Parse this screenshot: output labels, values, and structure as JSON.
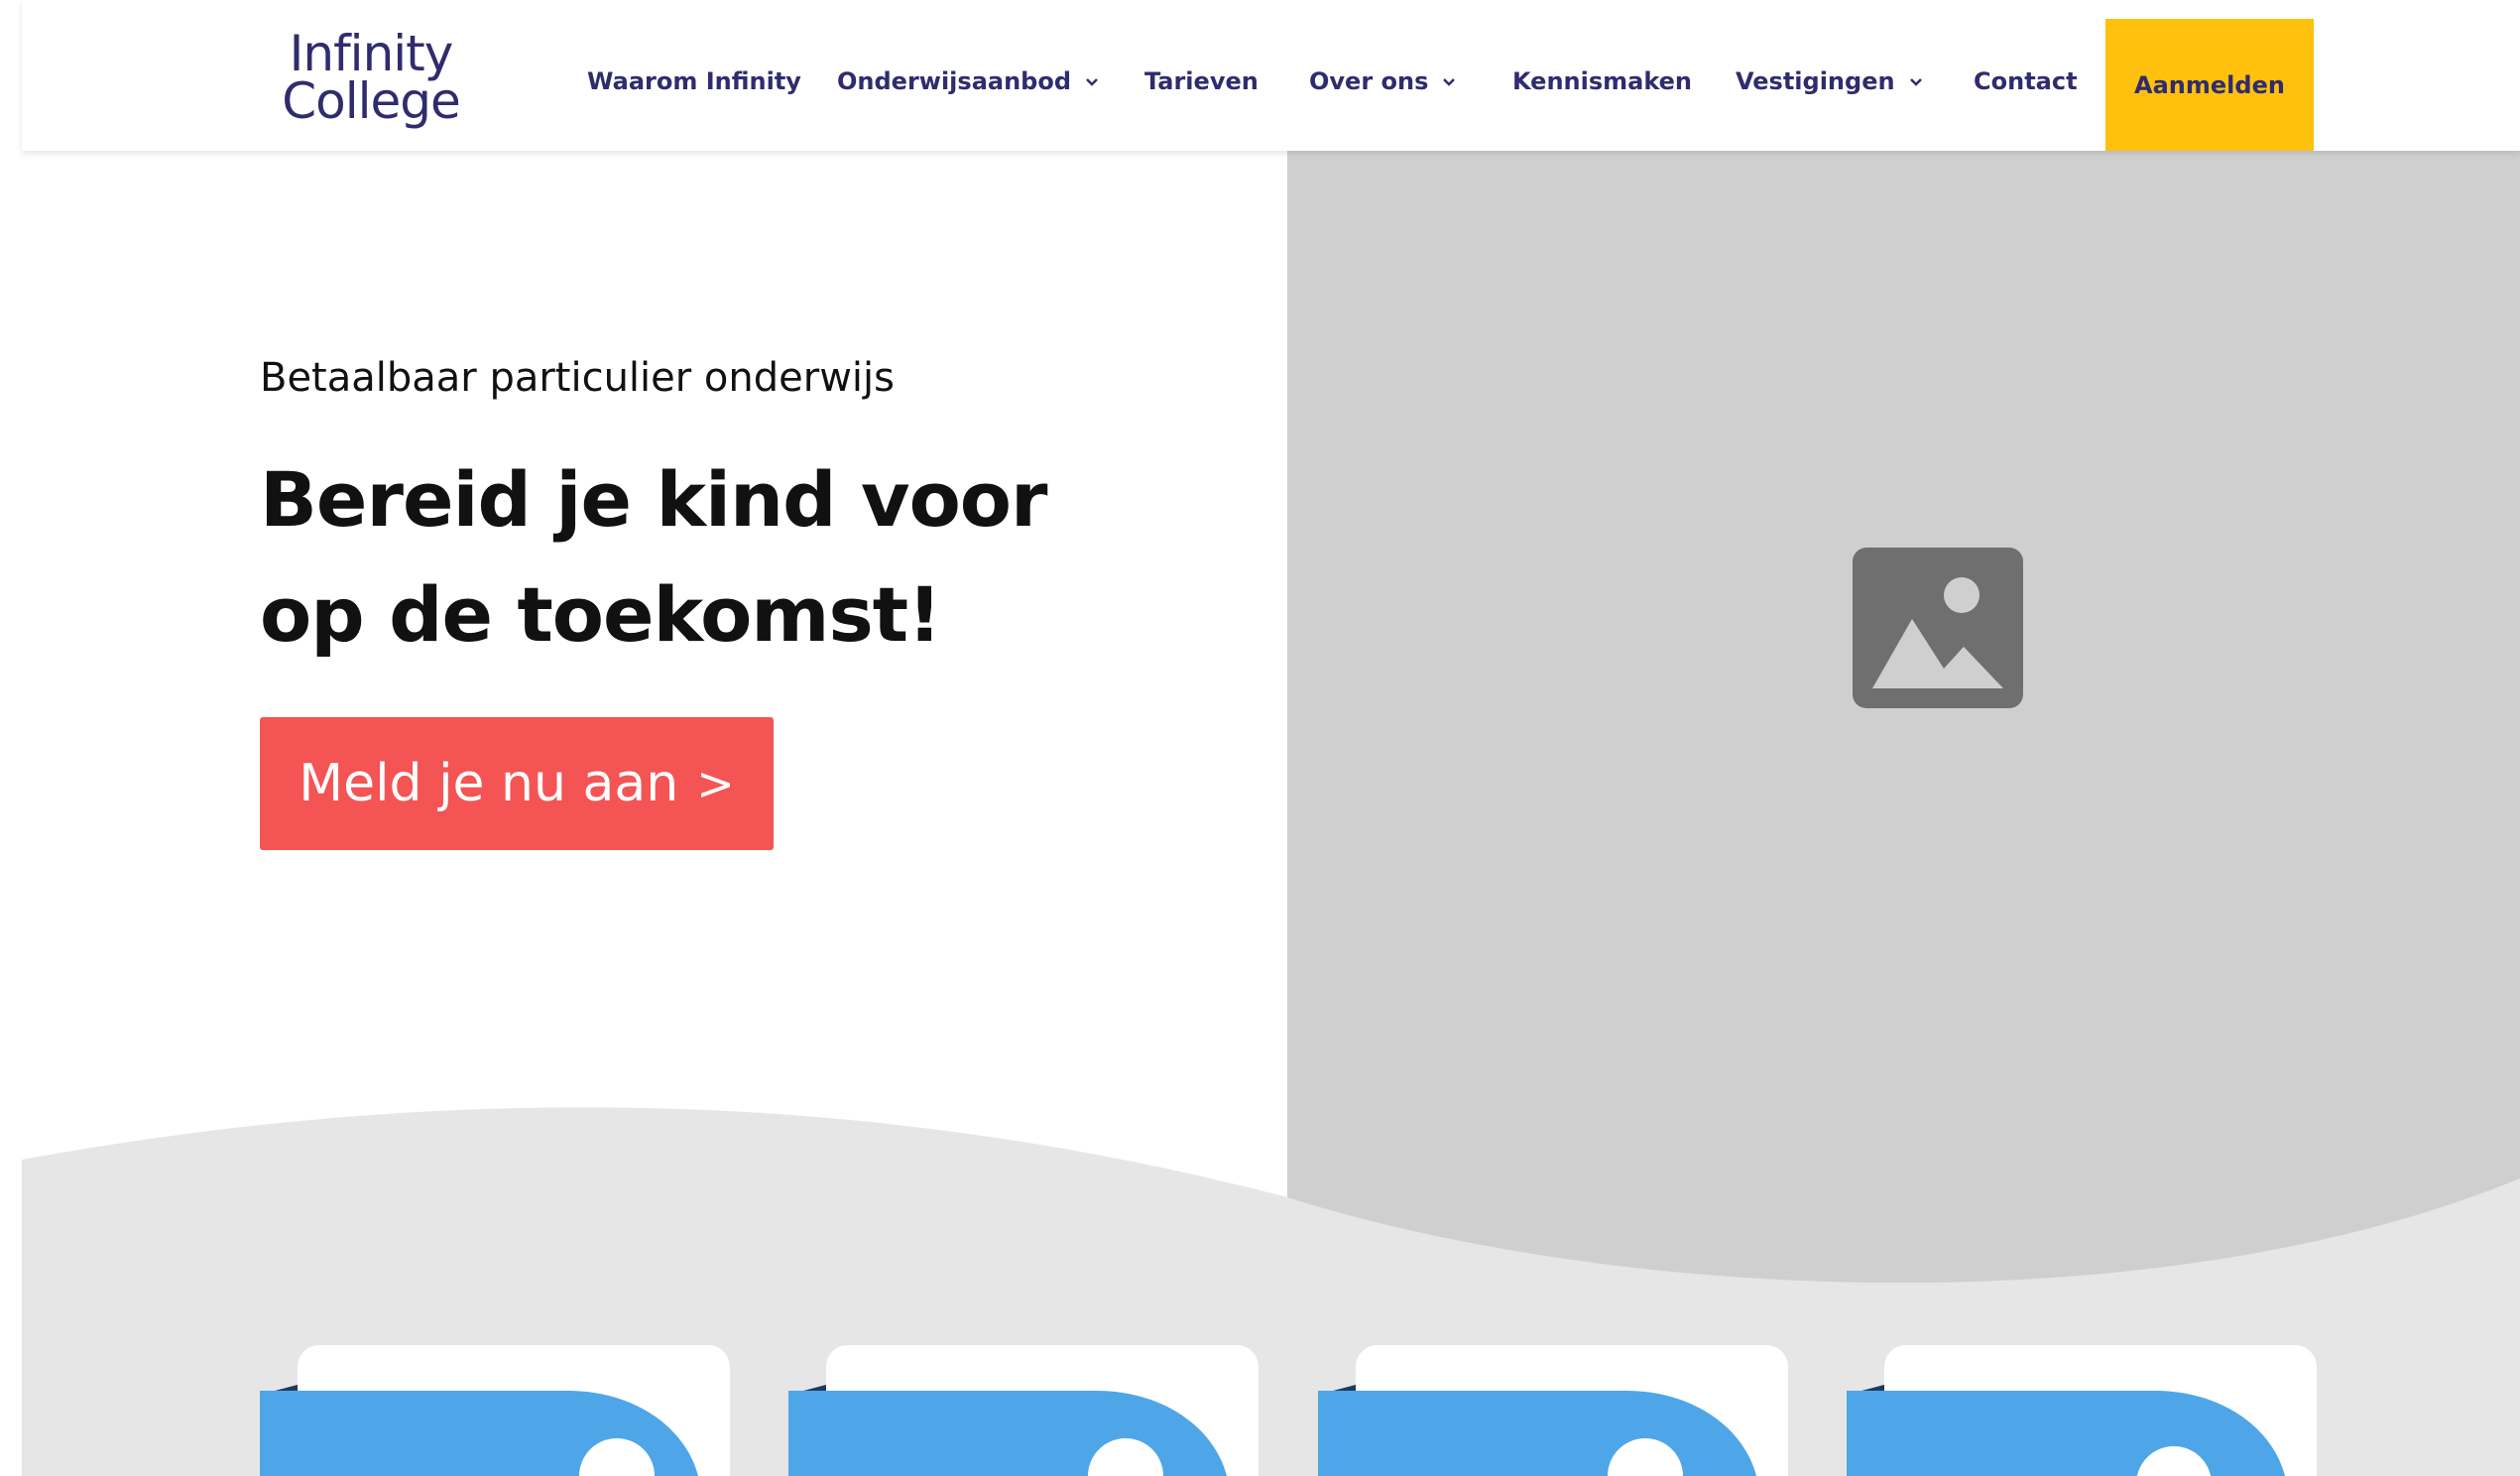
{
  "brand": {
    "logo_line1": "Infinity",
    "logo_line2": "College",
    "colors": {
      "navy": "#2f2c6e",
      "yellow": "#ffc10e",
      "coral": "#f45454",
      "blue": "#4ea6e8",
      "gray_image": "#cfcfcf",
      "wave_gray": "#e6e6e6"
    }
  },
  "nav": {
    "items": [
      {
        "label": "Waarom Infinity",
        "has_dropdown": false
      },
      {
        "label": "Onderwijsaanbod",
        "has_dropdown": true
      },
      {
        "label": "Tarieven",
        "has_dropdown": false
      },
      {
        "label": "Over ons",
        "has_dropdown": true
      },
      {
        "label": "Kennismaken",
        "has_dropdown": false
      },
      {
        "label": "Vestigingen",
        "has_dropdown": true
      },
      {
        "label": "Contact",
        "has_dropdown": false
      }
    ],
    "cta_label": "Aanmelden"
  },
  "hero": {
    "eyebrow": "Betaalbaar particulier onderwijs",
    "title_line1": "Bereid je kind voor",
    "title_line2": "op de toekomst!",
    "button_label": "Meld je nu aan",
    "button_arrow": ">",
    "image_icon": "image-placeholder-icon"
  },
  "cards": [
    {
      "name": "card-1"
    },
    {
      "name": "card-2"
    },
    {
      "name": "card-3"
    },
    {
      "name": "card-4"
    }
  ]
}
